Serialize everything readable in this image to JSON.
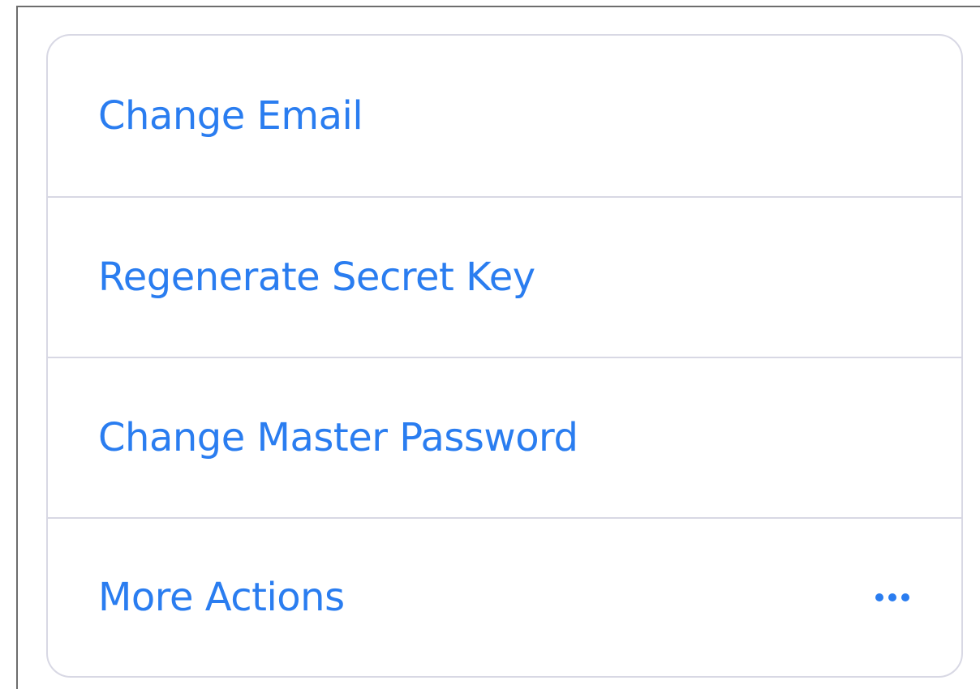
{
  "menu": {
    "items": [
      {
        "label": "Change Email"
      },
      {
        "label": "Regenerate Secret Key"
      },
      {
        "label": "Change Master Password"
      },
      {
        "label": "More Actions",
        "icon": "more-horizontal-icon"
      }
    ]
  },
  "colors": {
    "link": "#2a7df0",
    "border": "#d8d8e4"
  }
}
